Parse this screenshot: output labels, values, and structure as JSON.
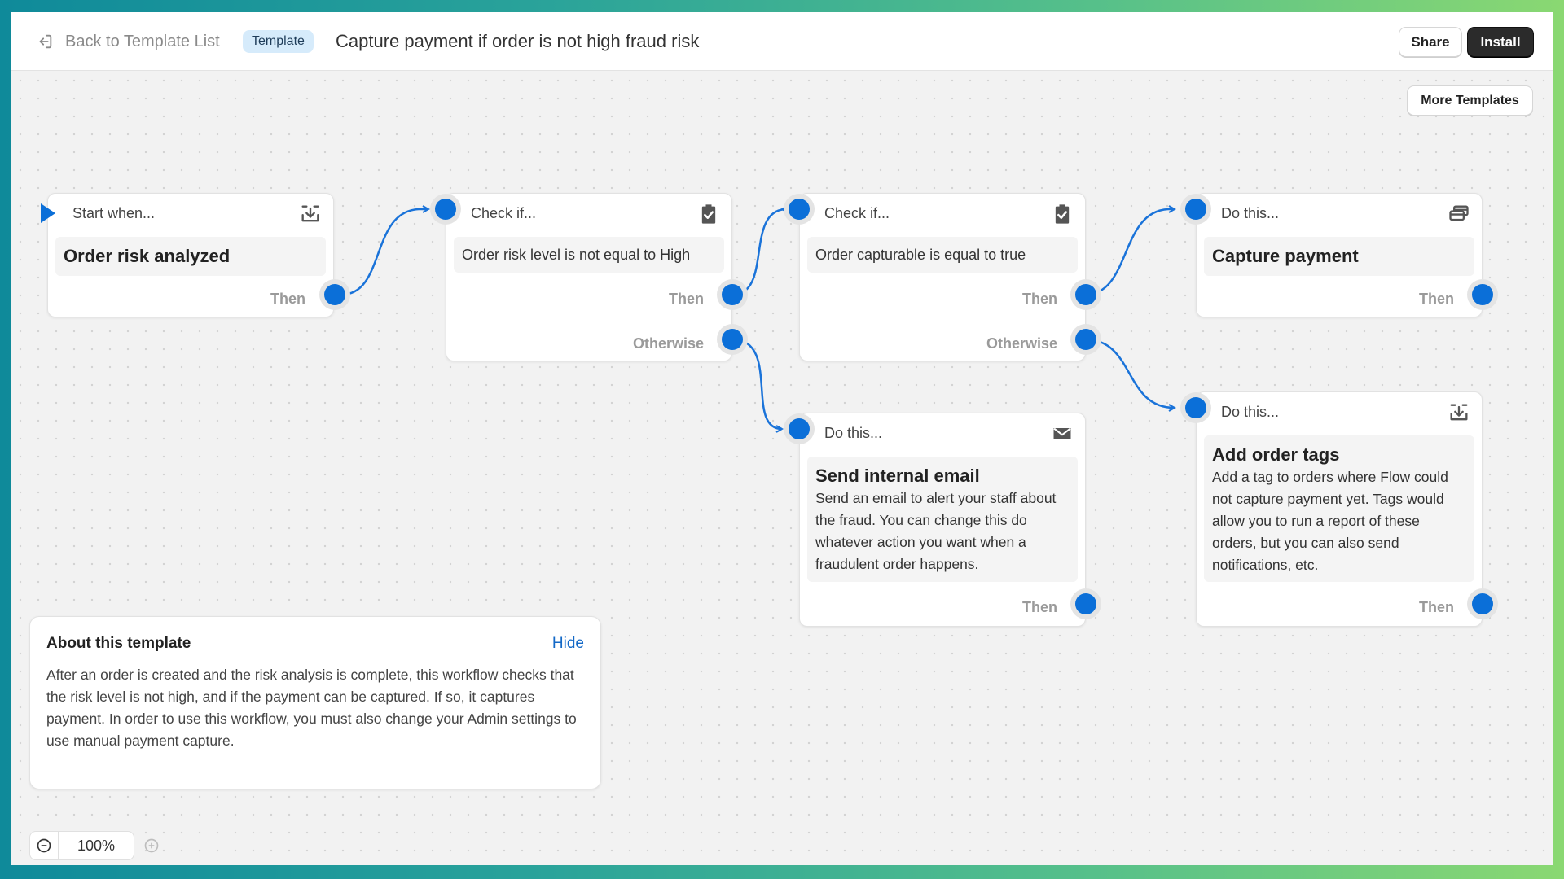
{
  "header": {
    "back_label": "Back to Template List",
    "badge": "Template",
    "title": "Capture payment if order is not high fraud risk",
    "share_label": "Share",
    "install_label": "Install"
  },
  "toolbar": {
    "more_templates_label": "More Templates"
  },
  "nodes": {
    "trigger": {
      "head": "Start when...",
      "title": "Order risk analyzed",
      "icon": "download-tray-icon",
      "then_label": "Then"
    },
    "check1": {
      "head": "Check if...",
      "condition": "Order risk level is not equal to High",
      "icon": "clipboard-check-icon",
      "then_label": "Then",
      "otherwise_label": "Otherwise"
    },
    "check2": {
      "head": "Check if...",
      "condition": "Order capturable is equal to true",
      "icon": "clipboard-check-icon",
      "then_label": "Then",
      "otherwise_label": "Otherwise"
    },
    "capture": {
      "head": "Do this...",
      "title": "Capture payment",
      "icon": "payment-cards-icon",
      "then_label": "Then"
    },
    "email": {
      "head": "Do this...",
      "title": "Send internal email",
      "description": "Send an email to alert your staff about the fraud. You can change this do whatever action you want when a fraudulent order happens.",
      "icon": "envelope-icon",
      "then_label": "Then"
    },
    "tags": {
      "head": "Do this...",
      "title": "Add order tags",
      "description": "Add a tag to orders where Flow could not capture payment yet. Tags would allow you to run a report of these orders, but you can also send notifications, etc.",
      "icon": "download-tray-icon",
      "then_label": "Then"
    }
  },
  "about": {
    "title": "About this template",
    "hide_label": "Hide",
    "text": "After an order is created and the risk analysis is complete, this workflow checks that the risk level is not high, and if the payment can be captured. If so, it captures payment. In order to use this workflow, you must also change your Admin settings to use manual payment capture."
  },
  "zoom": {
    "level": "100%"
  },
  "colors": {
    "accent": "#0b6fd8",
    "link": "#1469c7",
    "badge_bg": "#d6ebfb",
    "primary_button": "#2b2b2b"
  }
}
